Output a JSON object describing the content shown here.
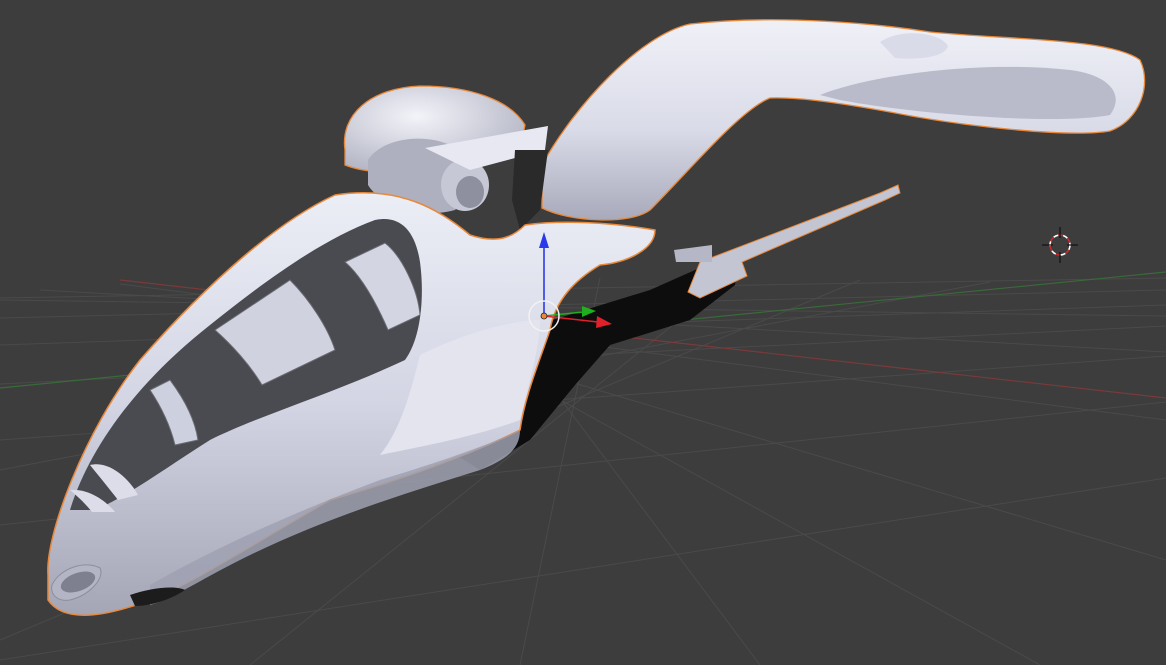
{
  "viewport": {
    "view": "perspective",
    "background_color": "#3d3d3d",
    "grid_line_color": "#4a4a4a",
    "x_axis_color": "#7a3a3a",
    "y_axis_color": "#3a6a3a"
  },
  "scene": {
    "selected_object": {
      "icon": "spaceship-mesh",
      "surface_color": "#d6d7e6",
      "shadow_color": "#0d0d0d",
      "panel_color": "#4a4b50",
      "selection_outline_color": "#e8883a"
    },
    "transform_gizmo": {
      "icon": "translate-manipulator",
      "x_axis_color": "#e0202a",
      "y_axis_color": "#1fb01f",
      "z_axis_color": "#2a3aeb",
      "origin_color": "#e8883a"
    },
    "cursor_3d": {
      "icon": "crosshair-target",
      "ring_color_a": "#cc2a2a",
      "ring_color_b": "#ffffff"
    }
  }
}
